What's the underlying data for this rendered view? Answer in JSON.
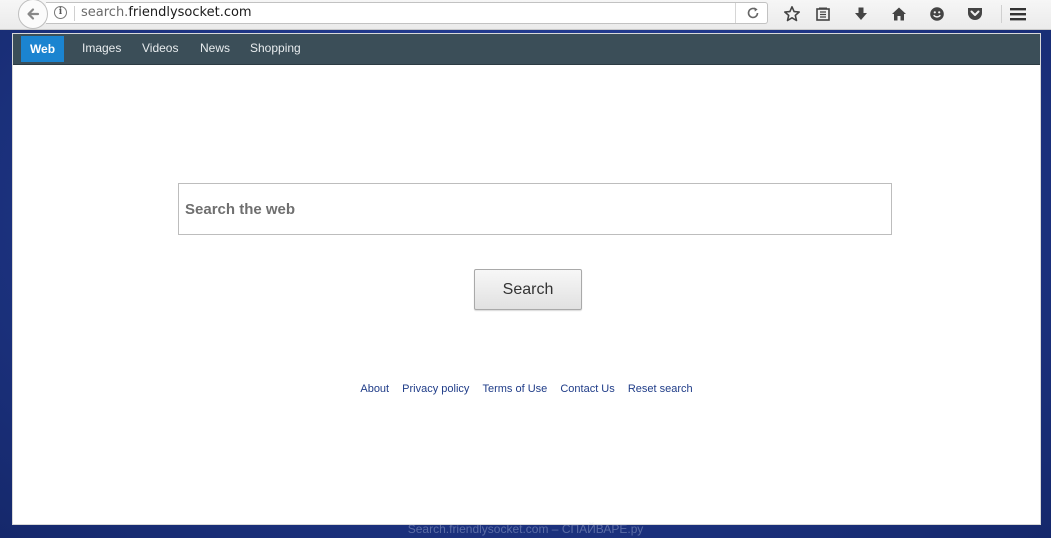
{
  "browser": {
    "url_prefix": "search.",
    "url_host": "friendlysocket.com"
  },
  "nav": {
    "items": [
      {
        "label": "Web",
        "active": true
      },
      {
        "label": "Images"
      },
      {
        "label": "Videos"
      },
      {
        "label": "News"
      },
      {
        "label": "Shopping"
      }
    ]
  },
  "search": {
    "placeholder": "Search the web",
    "button_label": "Search"
  },
  "footer": {
    "links": [
      "About",
      "Privacy policy",
      "Terms of Use",
      "Contact Us",
      "Reset search"
    ]
  },
  "watermark": "Search.friendlysocket.com – СПАЙВАРЕ.ру",
  "colors": {
    "nav_bg": "#3b4e58",
    "nav_active": "#1b84d0",
    "link": "#1f3c88",
    "desktop_bg": "#1e3585"
  },
  "icons": [
    "back-arrow-icon",
    "info-icon",
    "reload-icon",
    "bookmark-star-icon",
    "reading-list-icon",
    "download-icon",
    "home-icon",
    "hello-icon",
    "pocket-icon",
    "hamburger-menu-icon"
  ]
}
